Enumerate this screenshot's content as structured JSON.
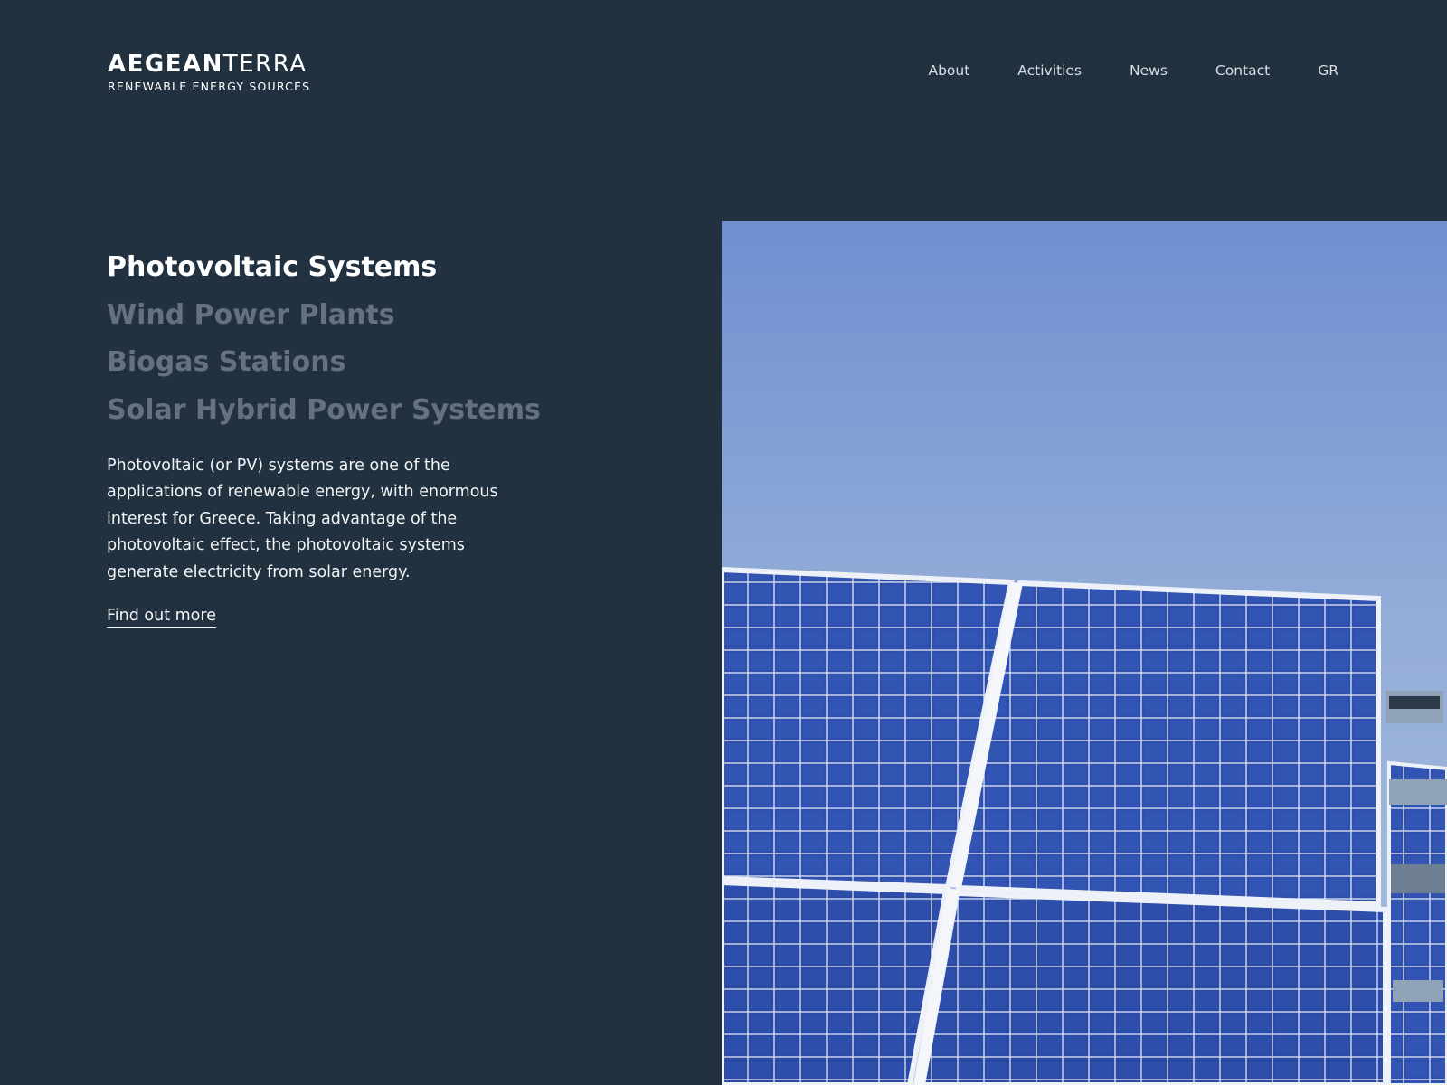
{
  "brand": {
    "name_bold": "AEGEAN",
    "name_light": "TERRA",
    "tagline": "RENEWABLE ENERGY SOURCES"
  },
  "nav": {
    "items": [
      {
        "label": "About"
      },
      {
        "label": "Activities"
      },
      {
        "label": "News"
      },
      {
        "label": "Contact"
      },
      {
        "label": "GR"
      }
    ]
  },
  "activities": {
    "items": [
      {
        "label": "Photovoltaic Systems",
        "active": true
      },
      {
        "label": "Wind Power Plants",
        "active": false
      },
      {
        "label": "Biogas Stations",
        "active": false
      },
      {
        "label": "Solar Hybrid Power Systems",
        "active": false
      }
    ],
    "description": "Photovoltaic (or PV) systems are one of the applications of renewable energy, with enormous interest for Greece. Taking advantage of the photovoltaic effect, the photovoltaic systems generate electricity from solar energy.",
    "link_label": "Find out more"
  },
  "colors": {
    "background": "#223140",
    "text": "#ffffff",
    "inactive_heading": "#66717d",
    "sky_top": "#6f8fd0",
    "sky_bottom": "#a9c0dd",
    "panel_cell": "#2f4fae"
  }
}
